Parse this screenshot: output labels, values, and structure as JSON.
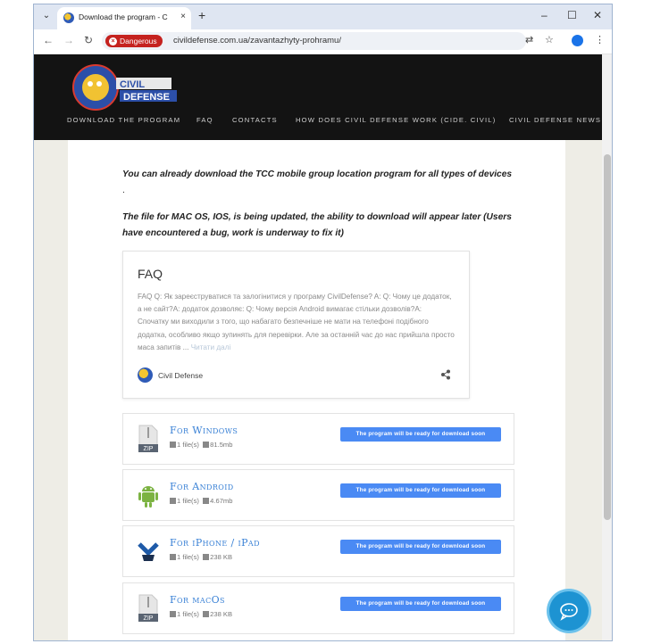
{
  "browser": {
    "tab_title": "Download the program - Civil D",
    "url": "civildefense.com.ua/zavantazhyty-prohramu/",
    "security_label": "Dangerous",
    "new_tab": "+",
    "tab_close": "×",
    "minimize": "–",
    "maximize": "☐",
    "close": "✕"
  },
  "site": {
    "logo_text": "CIVIL DEFENSE",
    "nav": [
      "DOWNLOAD THE PROGRAM",
      "FAQ",
      "CONTACTS",
      "HOW DOES CIVIL DEFENSE WORK (CIDE. CIVIL)",
      "CIVIL DEFENSE NEWS"
    ]
  },
  "content": {
    "line1": "You can already download the TCC mobile group location program for all types of devices",
    "line1_dot": ".",
    "line2": "The file for MAC OS, IOS, is being updated, the ability to download will appear later (Users have encountered a bug, work is underway to fix it)",
    "faq": {
      "title": "FAQ",
      "text": "FAQ Q: Як зареєструватися та залогінитися у програму CivilDefense? A: Q: Чому це додаток, а не сайт?A: додаток дозволяє: Q: Чому версія Android вимагає стільки дозволів?A: Спочатку ми виходили з того, що набагато безпечніше не мати на телефоні подібного додатка, особливо якщо зупинять для перевірки. Але за останній час до нас прийшла просто маса запитів ...",
      "read_more": "Читати далі",
      "author": "Civil Defense"
    },
    "downloads": [
      {
        "title": "For Windows",
        "files": "1 file(s)",
        "size": "81.5mb",
        "icon": "zip-icon",
        "button": "The program will be ready for download soon"
      },
      {
        "title": "For Android",
        "files": "1 file(s)",
        "size": "4.67mb",
        "icon": "android-icon",
        "button": "The program will be ready for download soon"
      },
      {
        "title": "For iPhone / iPad",
        "files": "1 file(s)",
        "size": "238 KB",
        "icon": "ipad-icon",
        "button": "The program will be ready for download soon"
      },
      {
        "title": "For macOs",
        "files": "1 file(s)",
        "size": "238 KB",
        "icon": "zip-icon",
        "button": "The program will be ready for download soon"
      }
    ],
    "zip_label": "ZIP"
  }
}
